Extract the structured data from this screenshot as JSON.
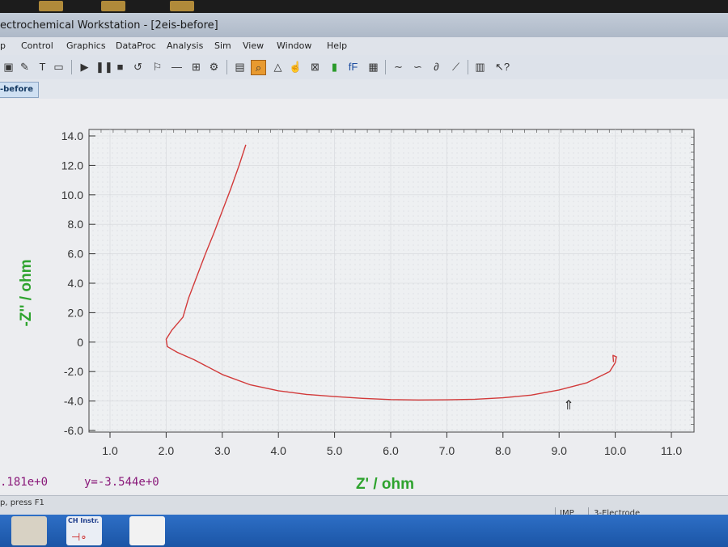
{
  "window": {
    "title": "ectrochemical Workstation - [2eis-before]"
  },
  "menu": [
    "p",
    "Control",
    "Graphics",
    "DataProc",
    "Analysis",
    "Sim",
    "View",
    "Window",
    "Help"
  ],
  "tab": {
    "label": "-before"
  },
  "toolbar": {
    "icons": [
      "open-icon",
      "text-icon",
      "frame-icon",
      "run-icon",
      "pause-icon",
      "stop-icon",
      "zoom-icon",
      "color-icon",
      "font-icon",
      "help-pointer-icon"
    ]
  },
  "chart_data": {
    "type": "line",
    "xlabel": "Z' / ohm",
    "ylabel": "-Z'' / ohm",
    "xlim": [
      1.0,
      11.0
    ],
    "ylim": [
      -6.0,
      14.0
    ],
    "x_ticks": [
      "1.0",
      "2.0",
      "3.0",
      "4.0",
      "5.0",
      "6.0",
      "7.0",
      "8.0",
      "9.0",
      "10.0",
      "11.0"
    ],
    "y_ticks": [
      "-6.0",
      "-4.0",
      "-2.0",
      "0",
      "2.0",
      "4.0",
      "6.0",
      "8.0",
      "10.0",
      "12.0",
      "14.0"
    ],
    "grid": true,
    "series": [
      {
        "color": "#d23a3a",
        "x": [
          3.42,
          3.3,
          3.15,
          3.0,
          2.85,
          2.7,
          2.55,
          2.4,
          2.3,
          2.1,
          2.0,
          2.02,
          2.2,
          2.5,
          3.0,
          3.5,
          4.0,
          4.5,
          5.0,
          5.5,
          6.0,
          6.5,
          7.0,
          7.5,
          8.0,
          8.5,
          9.0,
          9.5,
          9.9,
          10.0,
          10.02,
          9.96,
          9.97
        ],
        "y": [
          13.4,
          12.0,
          10.4,
          8.9,
          7.4,
          6.0,
          4.5,
          3.0,
          1.7,
          0.8,
          0.2,
          -0.3,
          -0.7,
          -1.2,
          -2.2,
          -2.9,
          -3.3,
          -3.55,
          -3.7,
          -3.82,
          -3.9,
          -3.93,
          -3.92,
          -3.88,
          -3.78,
          -3.6,
          -3.25,
          -2.75,
          -2.0,
          -1.4,
          -1.0,
          -0.9,
          -1.35
        ]
      }
    ]
  },
  "status": {
    "x_readout": ".181e+0",
    "y_readout": "y=-3.544e+0",
    "hint": "p, press F1",
    "mode": "IMP",
    "electrode": "3-Electrode"
  },
  "taskbar": {
    "app_label": "CH Instr."
  }
}
